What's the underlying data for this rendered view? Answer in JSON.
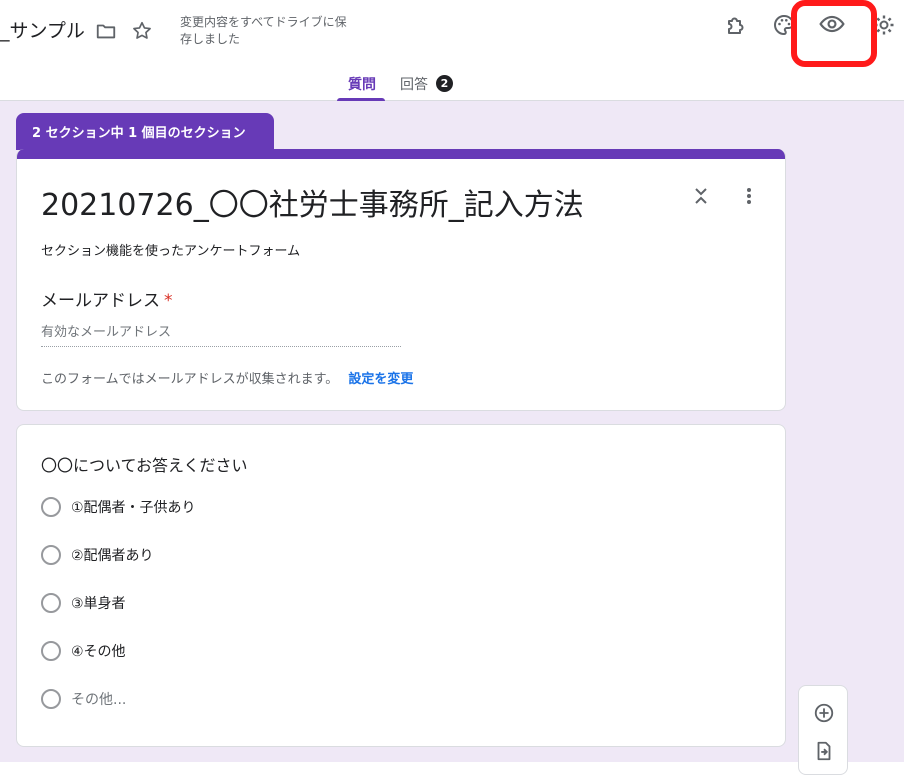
{
  "header": {
    "doc_title": "_サンプル",
    "save_status": "変更内容をすべてドライブに保存しました"
  },
  "tabs": [
    {
      "label": "質問",
      "active": true
    },
    {
      "label": "回答",
      "badge": "2"
    }
  ],
  "section": {
    "tab_label": "2 セクション中 1 個目のセクション"
  },
  "form": {
    "title": "20210726_〇〇社労士事務所_記入方法",
    "description": "セクション機能を使ったアンケートフォーム",
    "email_label": "メールアドレス",
    "email_required_mark": "*",
    "email_placeholder": "有効なメールアドレス",
    "collect_note": "このフォームではメールアドレスが収集されます。",
    "settings_link": "設定を変更"
  },
  "question": {
    "title": "〇〇についてお答えください",
    "options": [
      "①配偶者・子供あり",
      "②配偶者あり",
      "③単身者",
      "④その他"
    ],
    "other_option": "その他..."
  },
  "colors": {
    "accent": "#673ab7",
    "canvas_bg": "#efe8f6",
    "highlight": "#ff1a1a",
    "link": "#1a73e8"
  },
  "icons": [
    "folder-icon",
    "star-icon",
    "addon-icon",
    "palette-icon",
    "preview-eye-icon",
    "settings-gear-icon",
    "collapse-icon",
    "more-vert-icon",
    "add-question-icon",
    "import-questions-icon"
  ]
}
